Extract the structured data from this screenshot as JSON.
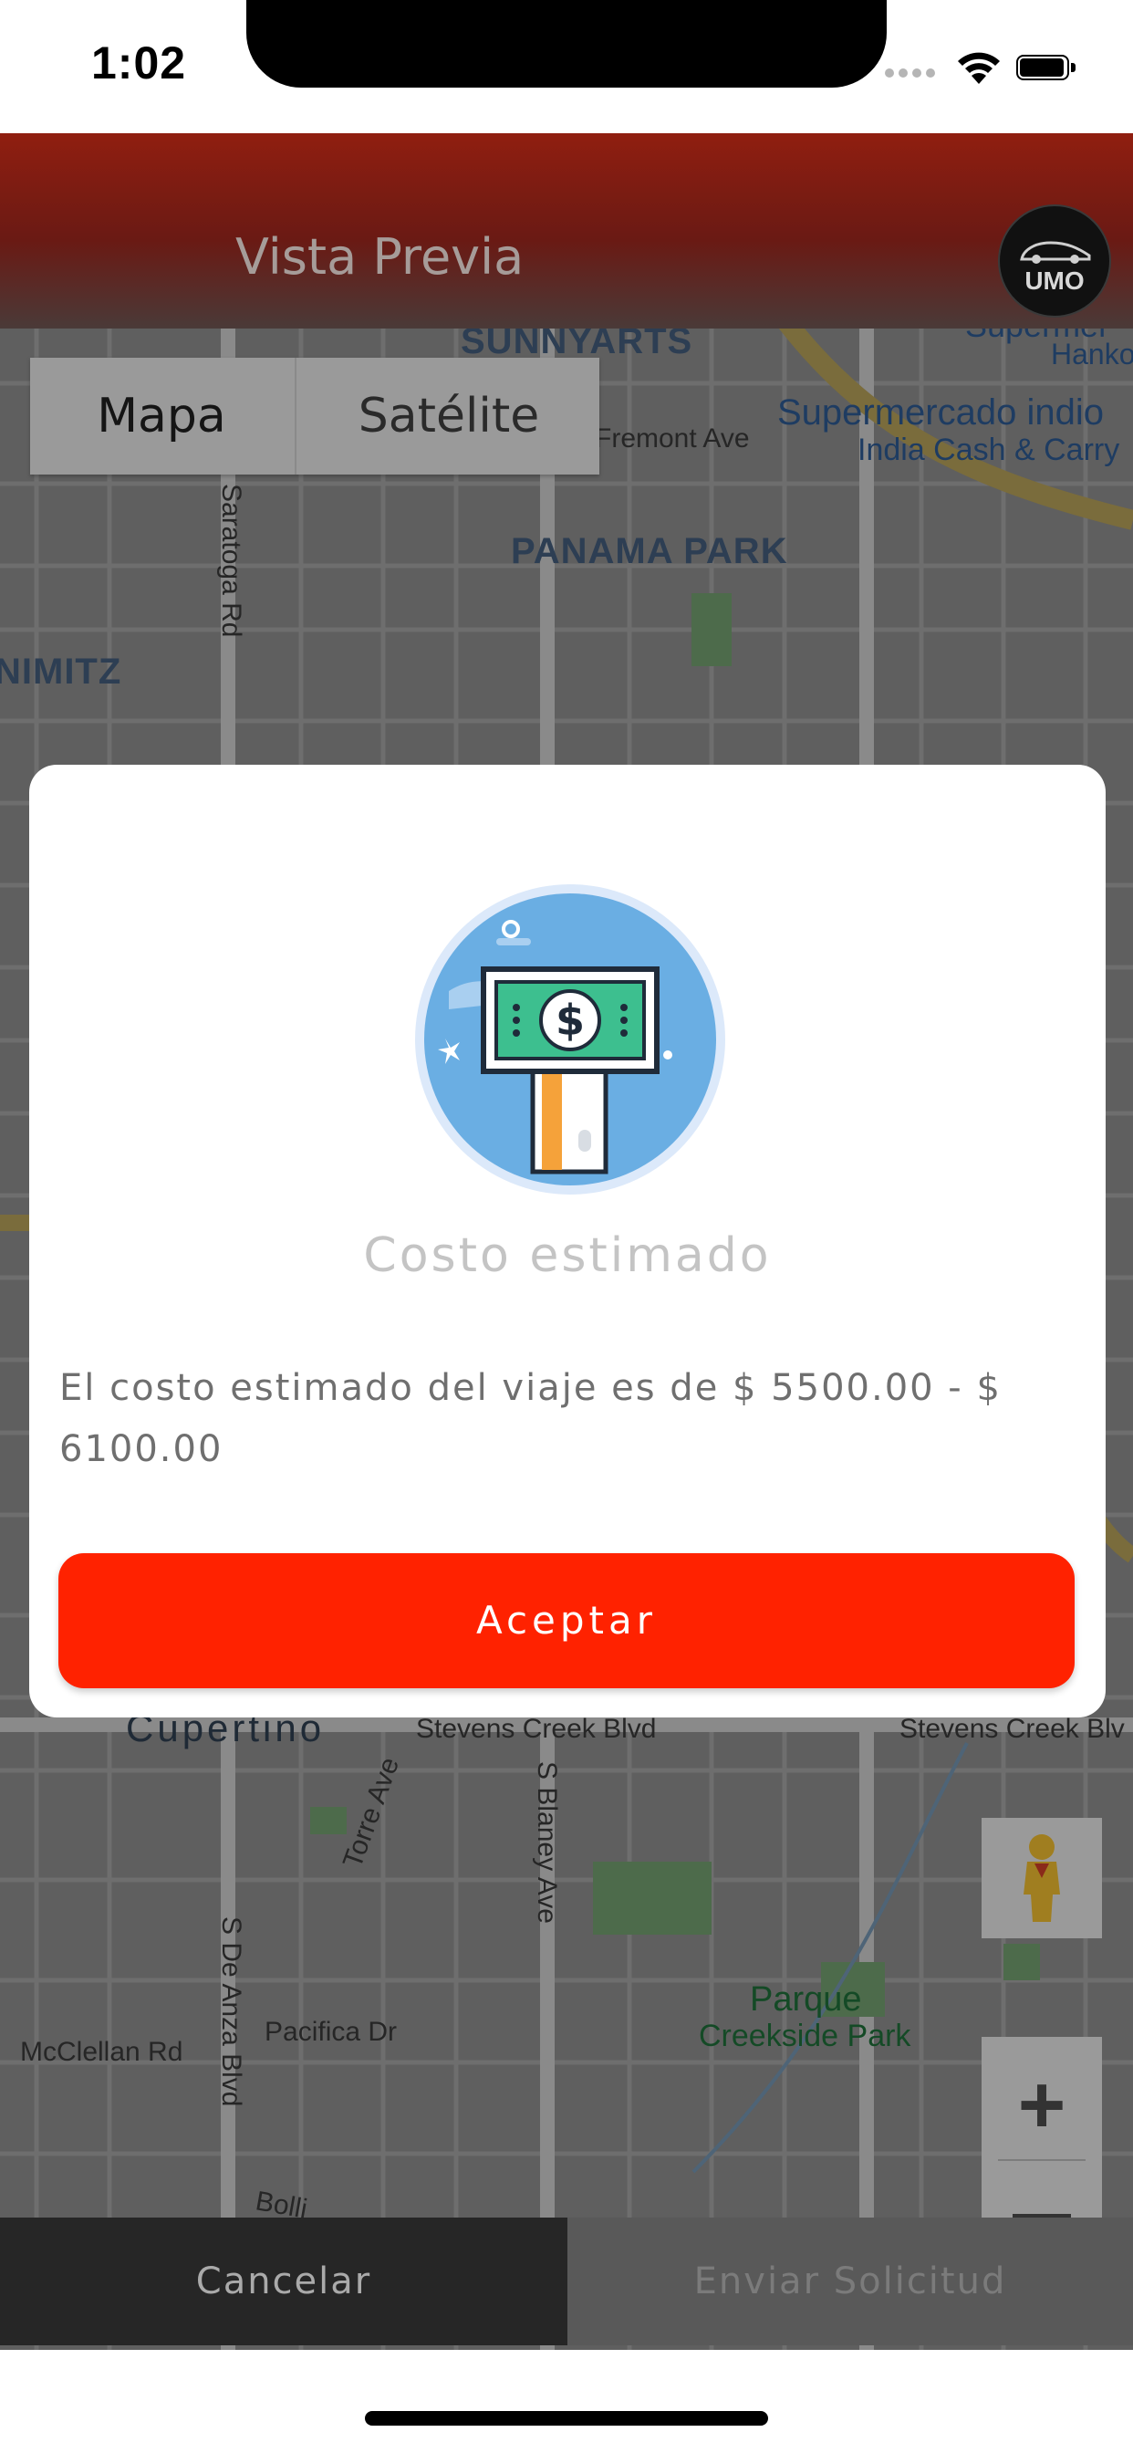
{
  "status_bar": {
    "time": "1:02"
  },
  "header": {
    "title": "Vista Previa",
    "logo_text": "UMO"
  },
  "map_type": {
    "map_label": "Mapa",
    "satellite_label": "Satélite",
    "selected": "Mapa"
  },
  "map": {
    "labels": {
      "sunnyarts": "SUNNYARTS",
      "supermarket_top": "Supermer",
      "hanko": "Hanko",
      "fremont": "Fremont Ave",
      "supermercado": "Supermercado indio",
      "india_cash": "India Cash & Carry",
      "saratoga": "Saratoga Rd",
      "panama_park": "PANAMA PARK",
      "nimitz": "NIMITZ",
      "cupertino": "Cupertino",
      "stevens_creek_1": "Stevens Creek Blvd",
      "stevens_creek_2": "Stevens Creek Blv",
      "torre": "Torre Ave",
      "blaney": "S Blaney Ave",
      "de_anza": "S De Anza Blvd",
      "mcclellan": "McClellan Rd",
      "pacifica": "Pacifica Dr",
      "parque": "Parque",
      "creekside": "Creekside Park",
      "bollinger": "Bolli"
    }
  },
  "modal": {
    "icon": "money-sign-icon",
    "title": "Costo estimado",
    "message": "El costo estimado del viaje es de $ 5500.00 - $ 6100.00",
    "accept_label": "Aceptar"
  },
  "bottom": {
    "cancel_label": "Cancelar",
    "send_label": "Enviar Solicitud"
  },
  "colors": {
    "header_red": "#901e10",
    "accept_red": "#ff2200",
    "cancel_bg": "#262626",
    "icon_circle": "#6aaee3"
  }
}
